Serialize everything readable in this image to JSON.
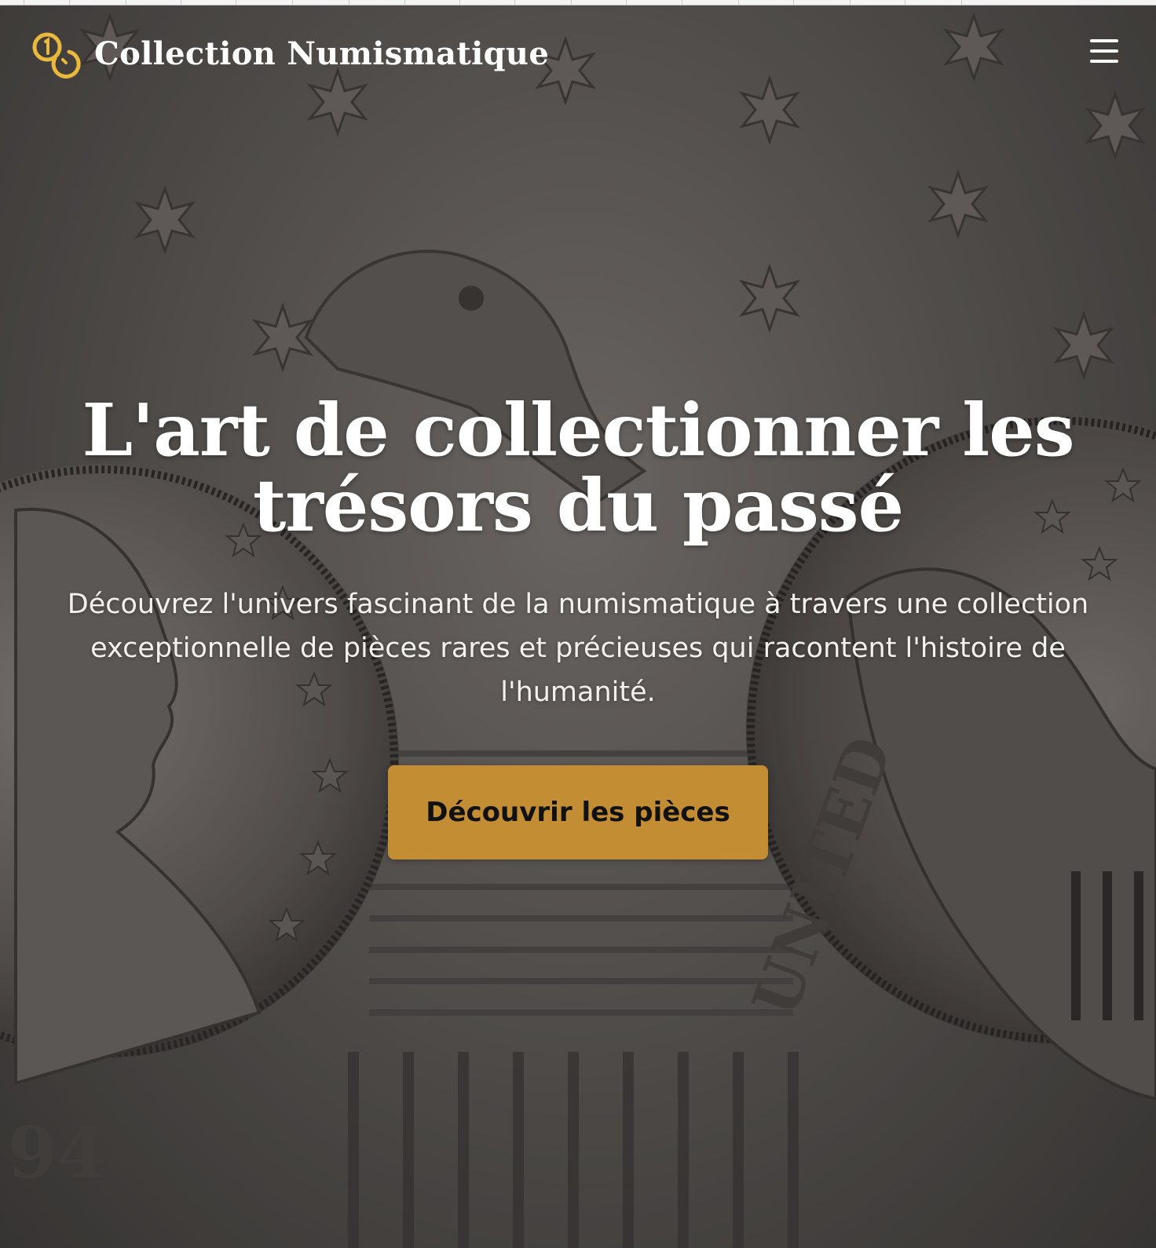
{
  "navbar": {
    "brand_title": "Collection Numismatique",
    "logo_icon": "coins-icon",
    "menu_icon": "hamburger-menu-icon"
  },
  "hero": {
    "title": "L'art de collectionner les trésors du passé",
    "subtitle": "Découvrez l'univers fascinant de la numismatique à travers une collection exceptionnelle de pièces rares et précieuses qui racontent l'histoire de l'humanité.",
    "cta_label": "Découvrir les pièces",
    "background_image": "antique-silver-coins-photo"
  },
  "colors": {
    "accent": "#c38d33",
    "logo_gold": "#e9b93b",
    "text_light": "#ffffff"
  }
}
